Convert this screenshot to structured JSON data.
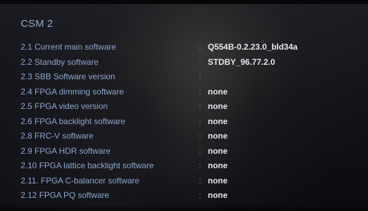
{
  "menu": {
    "title": "CSM 2",
    "rows": [
      {
        "label": "2.1 Current main software",
        "sep": ":",
        "value": "Q554B-0.2.23.0_bld34a"
      },
      {
        "label": "2.2 Standby software",
        "sep": ":",
        "value": "STDBY_96.77.2.0"
      },
      {
        "label": "2.3 SBB Software version",
        "sep": ":",
        "value": ""
      },
      {
        "label": "2.4 FPGA dimming software",
        "sep": ":",
        "value": "none"
      },
      {
        "label": "2.5 FPGA video version",
        "sep": ":",
        "value": "none"
      },
      {
        "label": "2.6 FPGA backlight software",
        "sep": ":",
        "value": "none"
      },
      {
        "label": "2.8 FRC-V software",
        "sep": ":",
        "value": "none"
      },
      {
        "label": "2.9 FPGA HDR software",
        "sep": ":",
        "value": "none"
      },
      {
        "label": "2.10 FPGA lattice backlight software",
        "sep": ":",
        "value": "none"
      },
      {
        "label": "2.11. FPGA C-balancer software",
        "sep": ":",
        "value": "none"
      },
      {
        "label": "2.12 FPGA PQ software",
        "sep": ":",
        "value": "none"
      }
    ]
  }
}
